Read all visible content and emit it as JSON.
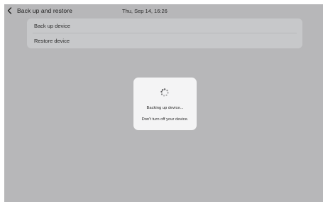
{
  "header": {
    "title": "Back up and restore",
    "datetime": "Thu, Sep 14, 16:26",
    "back_icon": "chevron-left-icon"
  },
  "menu": {
    "items": [
      {
        "label": "Back up device"
      },
      {
        "label": "Restore device"
      }
    ]
  },
  "dialog": {
    "icon": "loading-spinner-icon",
    "status": "Backing up device...",
    "warning": "Don't turn off your device."
  },
  "colors": {
    "overlay": "#b7b7b9",
    "list_background": "#c7c8ca",
    "dialog_background": "#f4f4f5"
  }
}
